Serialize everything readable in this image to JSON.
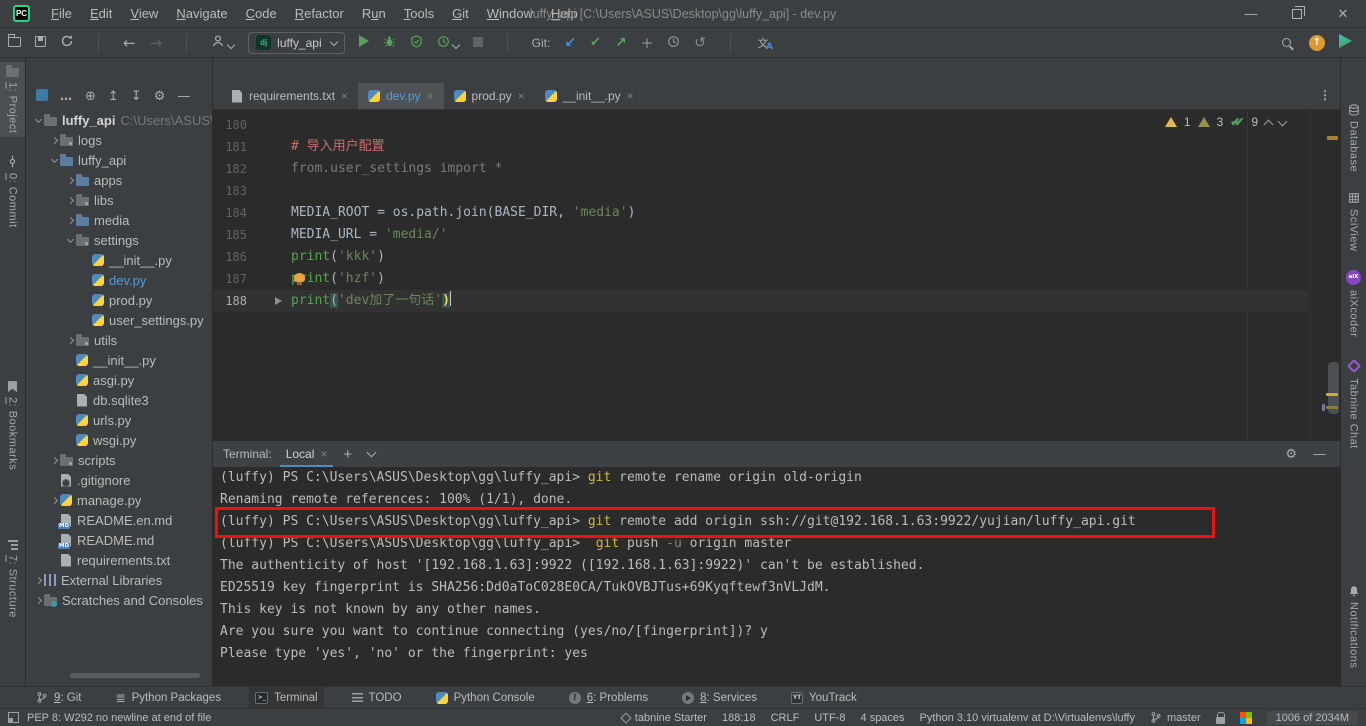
{
  "window": {
    "title": "luffy_api [C:\\Users\\ASUS\\Desktop\\gg\\luffy_api] - dev.py",
    "menu": [
      {
        "label": "File",
        "ul": 0
      },
      {
        "label": "Edit",
        "ul": 0
      },
      {
        "label": "View",
        "ul": 0
      },
      {
        "label": "Navigate",
        "ul": 0
      },
      {
        "label": "Code",
        "ul": 0
      },
      {
        "label": "Refactor",
        "ul": 0
      },
      {
        "label": "Run",
        "ul": 1
      },
      {
        "label": "Tools",
        "ul": 0
      },
      {
        "label": "Git",
        "ul": 0
      },
      {
        "label": "Window",
        "ul": 0
      },
      {
        "label": "Help",
        "ul": 0
      }
    ],
    "controls": [
      "minimize",
      "maximize",
      "close"
    ],
    "control_glyphs": {
      "minimize": "—",
      "close": "✕"
    }
  },
  "toolbar": {
    "run_config": "luffy_api",
    "dj_badge": "dj",
    "git_label": "Git:",
    "translate_glyph": "文",
    "update_glyph": "↑",
    "glyphs": {
      "back": "←",
      "fwd": "→",
      "pull": "↙",
      "commit-check": "✔",
      "push": "↗",
      "plus": "+",
      "undo": "↺",
      "target": "⊕",
      "gear": "⚙",
      "expand-all": "↥",
      "collapse-all": "↧",
      "minimize": "—",
      "packages": "≣",
      "ellipsis": "…",
      "problems": "!",
      "youtrack": "YT"
    },
    "items": [
      {
        "i": "open"
      },
      {
        "i": "save"
      },
      {
        "i": "sync"
      },
      {
        "sep": 1
      },
      {
        "i": "back"
      },
      {
        "i": "fwd"
      },
      {
        "sep": 1
      },
      {
        "i": "user",
        "chev": 1
      },
      {
        "combo": 1
      },
      {
        "i": "play"
      },
      {
        "i": "bug"
      },
      {
        "i": "coverage"
      },
      {
        "i": "profiler",
        "chev": 1
      },
      {
        "i": "stop"
      },
      {
        "sep": 1
      },
      {
        "text": "git_label"
      },
      {
        "i": "pull"
      },
      {
        "i": "commit-check"
      },
      {
        "i": "push"
      },
      {
        "i": "plus"
      },
      {
        "i": "clock"
      },
      {
        "i": "undo"
      },
      {
        "sep": 1
      },
      {
        "i": "translate"
      }
    ],
    "items_right": [
      {
        "i": "search"
      },
      {
        "i": "update"
      },
      {
        "i": "plugin-tri"
      }
    ]
  },
  "project": {
    "header_icons": [
      "view-selector",
      "ellipsis",
      "target",
      "expand-all",
      "collapse-all",
      "gear",
      "minimize"
    ],
    "items": [
      {
        "d": 0,
        "chev": "down",
        "icon": "folder-dim",
        "label": "luffy_api",
        "sub": "C:\\Users\\ASUS\\D",
        "bold": true
      },
      {
        "d": 1,
        "chev": "right",
        "icon": "folder-x",
        "label": "logs"
      },
      {
        "d": 1,
        "chev": "down",
        "icon": "folder",
        "label": "luffy_api"
      },
      {
        "d": 2,
        "chev": "right",
        "icon": "folder",
        "label": "apps"
      },
      {
        "d": 2,
        "chev": "right",
        "icon": "folder-x",
        "label": "libs"
      },
      {
        "d": 2,
        "chev": "right",
        "icon": "folder",
        "label": "media"
      },
      {
        "d": 2,
        "chev": "down",
        "icon": "folder-x",
        "label": "settings"
      },
      {
        "d": 3,
        "icon": "python",
        "label": "__init__.py"
      },
      {
        "d": 3,
        "icon": "python",
        "label": "dev.py",
        "sel": true
      },
      {
        "d": 3,
        "icon": "python",
        "label": "prod.py"
      },
      {
        "d": 3,
        "icon": "python",
        "label": "user_settings.py"
      },
      {
        "d": 2,
        "chev": "right",
        "icon": "folder-x",
        "label": "utils"
      },
      {
        "d": 2,
        "icon": "python",
        "label": "__init__.py"
      },
      {
        "d": 2,
        "icon": "python",
        "label": "asgi.py"
      },
      {
        "d": 2,
        "icon": "file",
        "label": "db.sqlite3"
      },
      {
        "d": 2,
        "icon": "python",
        "label": "urls.py"
      },
      {
        "d": 2,
        "icon": "python",
        "label": "wsgi.py"
      },
      {
        "d": 1,
        "chev": "right",
        "icon": "folder-x",
        "label": "scripts"
      },
      {
        "d": 1,
        "icon": "gitignore",
        "label": ".gitignore"
      },
      {
        "d": 1,
        "chev": "right",
        "icon": "python",
        "label": "manage.py"
      },
      {
        "d": 1,
        "icon": "md",
        "label": "README.en.md"
      },
      {
        "d": 1,
        "icon": "md",
        "label": "README.md"
      },
      {
        "d": 1,
        "icon": "file",
        "label": "requirements.txt"
      },
      {
        "d": 0,
        "chev": "right",
        "icon": "extlib",
        "label": "External Libraries"
      },
      {
        "d": 0,
        "chev": "right",
        "icon": "scratches",
        "label": "Scratches and Consoles"
      }
    ]
  },
  "editor": {
    "tabs": [
      {
        "label": "requirements.txt",
        "icon": "file",
        "active": false
      },
      {
        "label": "dev.py",
        "icon": "python",
        "active": true
      },
      {
        "label": "prod.py",
        "icon": "python",
        "active": false
      },
      {
        "label": "__init__.py",
        "icon": "python",
        "active": false
      }
    ],
    "close_glyph": "×",
    "inspections": {
      "warnings": "1",
      "weak_warnings": "3",
      "passed": "9",
      "checks_glyph": "✔✔"
    },
    "lines": [
      {
        "n": "180",
        "seg": []
      },
      {
        "n": "181",
        "seg": [
          {
            "t": "# 导入用户配置",
            "c": "com"
          }
        ]
      },
      {
        "n": "182",
        "seg": [
          {
            "t": "from.user_settings import *",
            "c": "gray"
          }
        ]
      },
      {
        "n": "183",
        "seg": []
      },
      {
        "n": "184",
        "seg": [
          {
            "t": "MEDIA_ROOT = os.path.join(BASE_DIR, ",
            "c": "def"
          },
          {
            "t": "'media'",
            "c": "str"
          },
          {
            "t": ")",
            "c": "def"
          }
        ]
      },
      {
        "n": "185",
        "seg": [
          {
            "t": "MEDIA_URL = ",
            "c": "def"
          },
          {
            "t": "'media/'",
            "c": "str"
          }
        ]
      },
      {
        "n": "186",
        "seg": [
          {
            "t": "print",
            "c": "kw"
          },
          {
            "t": "(",
            "c": "def"
          },
          {
            "t": "'kkk'",
            "c": "str"
          },
          {
            "t": ")",
            "c": "def"
          }
        ]
      },
      {
        "n": "187",
        "bulb": true,
        "seg": [
          {
            "t": "print",
            "c": "kw"
          },
          {
            "t": "(",
            "c": "def"
          },
          {
            "t": "'hzf'",
            "c": "str"
          },
          {
            "t": ")",
            "c": "def"
          }
        ]
      },
      {
        "n": "188",
        "current": true,
        "caret": true,
        "marker": true,
        "seg": [
          {
            "t": "print",
            "c": "kw"
          },
          {
            "t": "(",
            "c": "brk"
          },
          {
            "t": "'dev加了一句话'",
            "c": "str"
          },
          {
            "t": ")",
            "c": "brky"
          }
        ]
      }
    ]
  },
  "terminal": {
    "label": "Terminal:",
    "tab": "Local",
    "tab_close": "×",
    "plus": "+",
    "boxed_line_index": 2,
    "lines": [
      [
        {
          "t": "(luffy) PS C:\\Users\\ASUS\\Desktop\\gg\\luffy_api> ",
          "c": "p"
        },
        {
          "t": "git",
          "c": "y"
        },
        {
          "t": " remote rename origin old-origin",
          "c": "p"
        }
      ],
      [
        {
          "t": "Renaming remote references: 100% (1/1), done.",
          "c": "p"
        }
      ],
      [
        {
          "t": "(luffy) PS C:\\Users\\ASUS\\Desktop\\gg\\luffy_api> ",
          "c": "p"
        },
        {
          "t": "git",
          "c": "y"
        },
        {
          "t": " remote add origin ssh://git@192.168.1.63:9922/yujian/luffy_api.git",
          "c": "p"
        }
      ],
      [
        {
          "t": "(luffy) PS C:\\Users\\ASUS\\Desktop\\gg\\luffy_api>  ",
          "c": "p"
        },
        {
          "t": "git",
          "c": "y"
        },
        {
          "t": " push ",
          "c": "p"
        },
        {
          "t": "-u",
          "c": "dim"
        },
        {
          "t": " origin master",
          "c": "p"
        }
      ],
      [
        {
          "t": "The authenticity of host '[192.168.1.63]:9922 ([192.168.1.63]:9922)' can't be established.",
          "c": "p"
        }
      ],
      [
        {
          "t": "ED25519 key fingerprint is SHA256:Dd0aToC028E0CA/TukOVBJTus+69Kyqftewf3nVLJdM.",
          "c": "p"
        }
      ],
      [
        {
          "t": "This key is not known by any other names.",
          "c": "p"
        }
      ],
      [
        {
          "t": "Are you sure you want to continue connecting (yes/no/[fingerprint])? y",
          "c": "p"
        }
      ],
      [
        {
          "t": "Please type 'yes', 'no' or the fingerprint: yes",
          "c": "p"
        }
      ]
    ]
  },
  "tool_window_bar": {
    "items": [
      {
        "label": "9: Git",
        "ul": 0,
        "icon": "branch"
      },
      {
        "label": "Python Packages",
        "icon": "packages"
      },
      {
        "label": "Terminal",
        "icon": "terminal-ico",
        "active": true
      },
      {
        "label": "TODO",
        "icon": "todo"
      },
      {
        "label": "Python Console",
        "icon": "python-console"
      },
      {
        "label": "6: Problems",
        "ul": 0,
        "icon": "problems"
      },
      {
        "label": "8: Services",
        "ul": 0,
        "icon": "services"
      },
      {
        "label": "YouTrack",
        "icon": "youtrack"
      }
    ]
  },
  "status_bar": {
    "left_icon": "window-switch",
    "left_text": "PEP 8: W292 no newline at end of file",
    "right": [
      {
        "icon": "tabnine",
        "label": "tabnine Starter"
      },
      {
        "label": "188:18"
      },
      {
        "label": "CRLF"
      },
      {
        "label": "UTF-8"
      },
      {
        "label": "4 spaces"
      },
      {
        "label": "Python 3.10 virtualenv at D:\\Virtualenvs\\luffy"
      },
      {
        "icon": "branch",
        "label": "master"
      },
      {
        "icon": "lock"
      },
      {
        "icon": "ms-squares"
      },
      {
        "label": "1006 of 2034M",
        "style": "memory"
      }
    ]
  },
  "strips": {
    "left": [
      {
        "label": "1: Project",
        "ul": 0,
        "icon": "project",
        "active": true
      },
      {
        "label": "0: Commit",
        "ul": 0,
        "icon": "commit"
      },
      {
        "label": "2: Bookmarks",
        "ul": 0,
        "icon": "bookmark"
      },
      {
        "label": "7: Structure",
        "ul": 0,
        "icon": "structure"
      }
    ],
    "right": [
      {
        "label": "Database",
        "icon": "database"
      },
      {
        "label": "SciView",
        "icon": "sciview"
      },
      {
        "label": "aiXcoder",
        "icon": "aixcoder"
      },
      {
        "label": "Tabnine Chat",
        "icon": "tabnine-chat"
      },
      {
        "label": "Notifications",
        "icon": "bell"
      }
    ]
  },
  "colors": {
    "accent_blue": "#4A8CC9",
    "git_yellow": "#D2B53C",
    "annotation_red": "#EF1010",
    "string_green": "#6A8759",
    "run_green": "#57A05A"
  }
}
